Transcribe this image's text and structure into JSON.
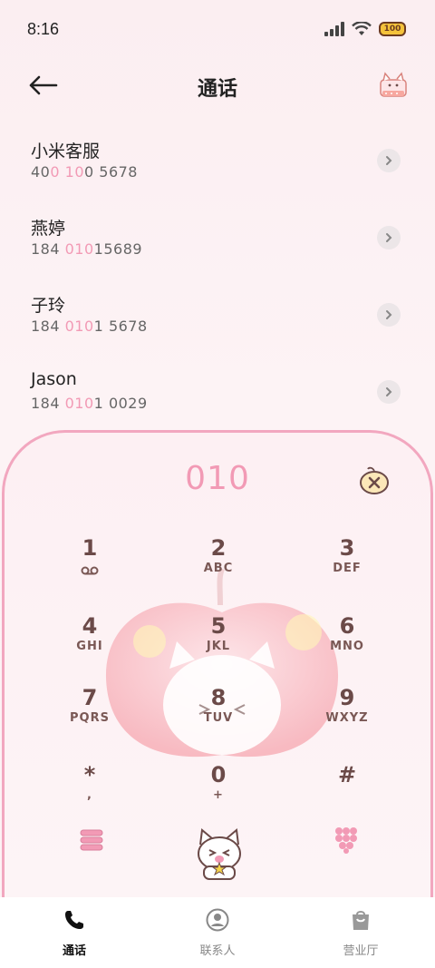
{
  "status": {
    "time": "8:16",
    "battery": "100"
  },
  "header": {
    "title": "通话"
  },
  "contacts": [
    {
      "name": "小米客服",
      "number_parts": [
        "40",
        "0",
        " ",
        "10",
        "0 5678"
      ]
    },
    {
      "name": "燕婷",
      "number_parts": [
        "184 ",
        "010",
        "15689",
        "",
        ""
      ]
    },
    {
      "name": "子玲",
      "number_parts": [
        "184 ",
        "010",
        "1 5678",
        "",
        ""
      ]
    },
    {
      "name": "Jason",
      "number_parts": [
        "184 ",
        "010",
        "1 0029",
        "",
        ""
      ]
    }
  ],
  "dialer": {
    "input": "010",
    "keys": [
      {
        "digit": "1",
        "letters": ""
      },
      {
        "digit": "2",
        "letters": "ABC"
      },
      {
        "digit": "3",
        "letters": "DEF"
      },
      {
        "digit": "4",
        "letters": "GHI"
      },
      {
        "digit": "5",
        "letters": "JKL"
      },
      {
        "digit": "6",
        "letters": "MNO"
      },
      {
        "digit": "7",
        "letters": "PQRS"
      },
      {
        "digit": "8",
        "letters": "TUV"
      },
      {
        "digit": "9",
        "letters": "WXYZ"
      },
      {
        "digit": "*",
        "letters": ","
      },
      {
        "digit": "0",
        "letters": "+"
      },
      {
        "digit": "#",
        "letters": ""
      }
    ],
    "colors": {
      "accent": "#f29ab5",
      "key_text": "#6b4a48",
      "border": "#f2a7bf"
    }
  },
  "bottom_nav": [
    {
      "label": "通话",
      "icon": "phone-icon",
      "active": true
    },
    {
      "label": "联系人",
      "icon": "contact-icon",
      "active": false
    },
    {
      "label": "营业厅",
      "icon": "shopping-bag-icon",
      "active": false
    }
  ]
}
